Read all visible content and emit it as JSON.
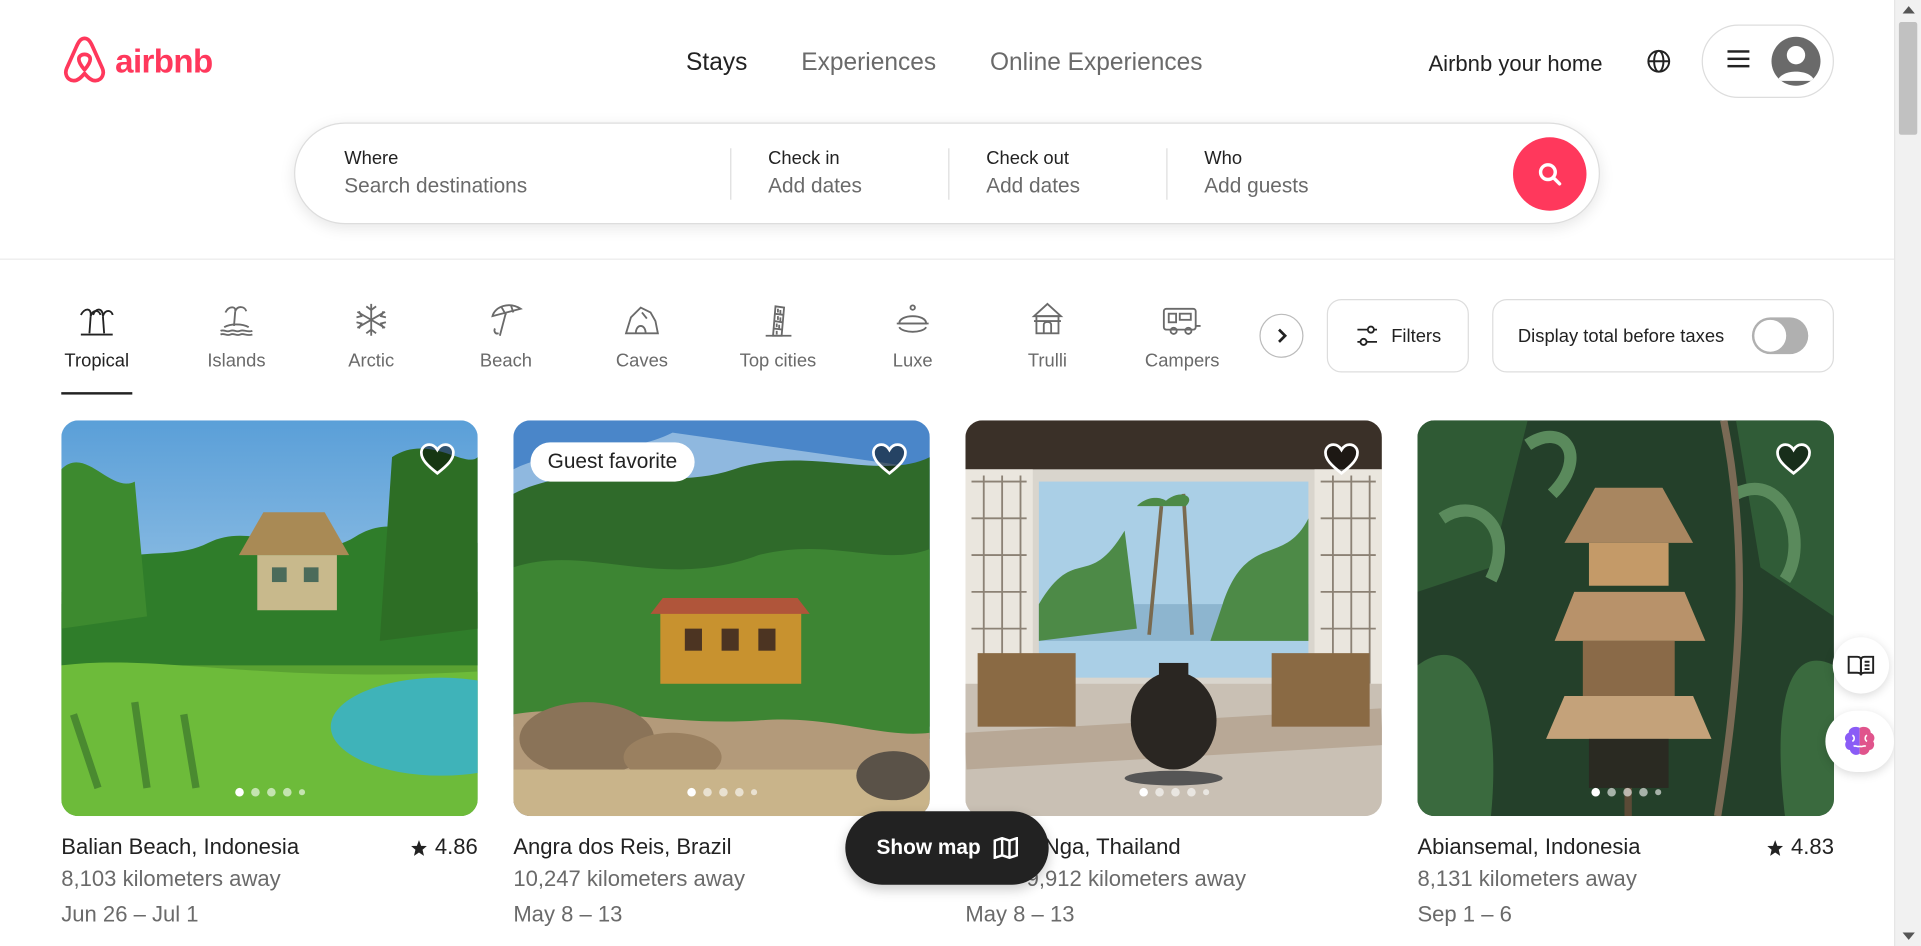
{
  "brand": {
    "name": "airbnb",
    "color": "#ff385c"
  },
  "nav": {
    "tabs": [
      "Stays",
      "Experiences",
      "Online Experiences"
    ],
    "active": "Stays"
  },
  "header": {
    "host_link": "Airbnb your home",
    "globe_icon": "globe-icon",
    "menu_icon": "hamburger-icon",
    "avatar_icon": "user-avatar-icon"
  },
  "search": {
    "where_label": "Where",
    "where_placeholder": "Search destinations",
    "checkin_label": "Check in",
    "checkin_placeholder": "Add dates",
    "checkout_label": "Check out",
    "checkout_placeholder": "Add dates",
    "who_label": "Who",
    "who_placeholder": "Add guests",
    "button_icon": "search-icon"
  },
  "categories": [
    {
      "label": "Tropical",
      "icon": "palm-tree-icon",
      "active": true
    },
    {
      "label": "Islands",
      "icon": "island-icon"
    },
    {
      "label": "Arctic",
      "icon": "snowflake-icon"
    },
    {
      "label": "Beach",
      "icon": "umbrella-icon"
    },
    {
      "label": "Caves",
      "icon": "cave-icon"
    },
    {
      "label": "Top cities",
      "icon": "tower-icon"
    },
    {
      "label": "Luxe",
      "icon": "cloche-icon"
    },
    {
      "label": "Trulli",
      "icon": "trulli-icon"
    },
    {
      "label": "Campers",
      "icon": "camper-icon"
    }
  ],
  "toolbar": {
    "filters_label": "Filters",
    "tax_label": "Display total before taxes",
    "tax_enabled": false
  },
  "listings": [
    {
      "title": "Balian Beach, Indonesia",
      "rating": "4.86",
      "distance": "8,103 kilometers away",
      "dates": "Jun 26 – Jul 1",
      "badge": ""
    },
    {
      "title": "Angra dos Reis, Brazil",
      "rating": "",
      "distance": "10,247 kilometers away",
      "dates": "May 8 – 13",
      "badge": "Guest favorite"
    },
    {
      "title": "Nga, Thailand",
      "rating": "",
      "distance": "9,912 kilometers away",
      "dates": "May 8 – 13",
      "badge": ""
    },
    {
      "title": "Abiansemal, Indonesia",
      "rating": "4.83",
      "distance": "8,131 kilometers away",
      "dates": "Sep 1 – 6",
      "badge": ""
    }
  ],
  "map_button": {
    "label": "Show map",
    "icon": "map-icon"
  }
}
